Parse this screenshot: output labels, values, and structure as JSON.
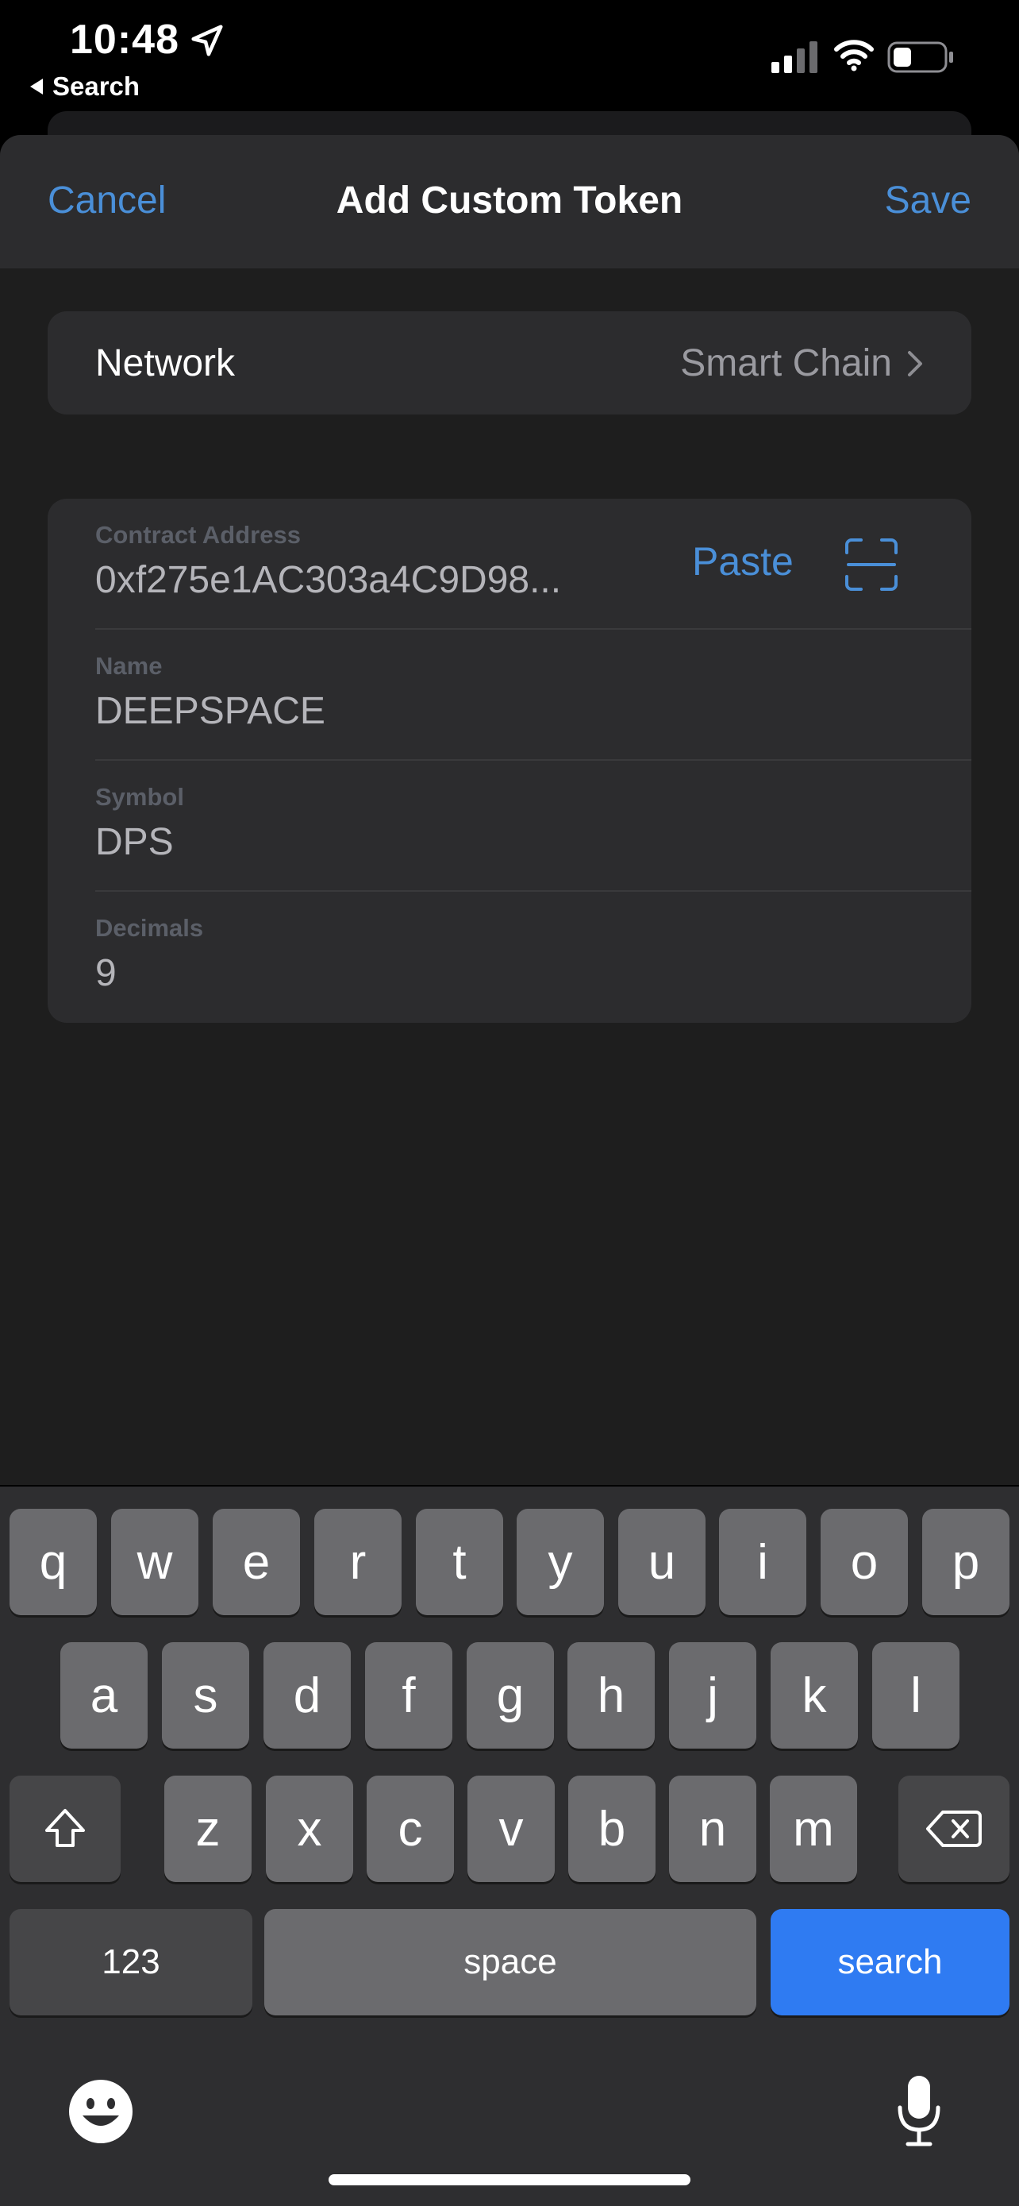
{
  "status_bar": {
    "time": "10:48",
    "back_label": "Search"
  },
  "nav": {
    "cancel": "Cancel",
    "title": "Add Custom Token",
    "save": "Save"
  },
  "network": {
    "label": "Network",
    "value": "Smart Chain"
  },
  "fields": {
    "contract": {
      "label": "Contract Address",
      "value": "0xf275e1AC303a4C9D98...",
      "paste": "Paste"
    },
    "name": {
      "label": "Name",
      "value": "DEEPSPACE"
    },
    "symbol": {
      "label": "Symbol",
      "value": "DPS"
    },
    "decimals": {
      "label": "Decimals",
      "value": "9"
    }
  },
  "keyboard": {
    "row1": [
      "q",
      "w",
      "e",
      "r",
      "t",
      "y",
      "u",
      "i",
      "o",
      "p"
    ],
    "row2": [
      "a",
      "s",
      "d",
      "f",
      "g",
      "h",
      "j",
      "k",
      "l"
    ],
    "row3": [
      "z",
      "x",
      "c",
      "v",
      "b",
      "n",
      "m"
    ],
    "numbers": "123",
    "space": "space",
    "action": "search"
  },
  "colors": {
    "accent": "#4a8fd8",
    "key_action": "#2f7bf2"
  }
}
